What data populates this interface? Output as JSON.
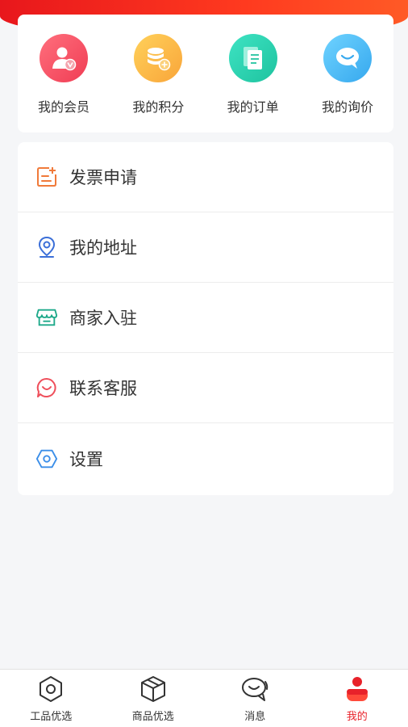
{
  "quick_actions": [
    {
      "label": "我的会员",
      "icon": "member-icon",
      "color": "#f03d54"
    },
    {
      "label": "我的积分",
      "icon": "coins-icon",
      "color": "#f9a53a"
    },
    {
      "label": "我的订单",
      "icon": "order-document-icon",
      "color": "#1ec39f"
    },
    {
      "label": "我的询价",
      "icon": "chat-bubble-icon",
      "color": "#36a8ee"
    }
  ],
  "menu": [
    {
      "label": "发票申请",
      "icon": "invoice-icon",
      "color": "#f07a3a"
    },
    {
      "label": "我的地址",
      "icon": "location-pin-icon",
      "color": "#3b6fd8"
    },
    {
      "label": "商家入驻",
      "icon": "storefront-icon",
      "color": "#1ea98a"
    },
    {
      "label": "联系客服",
      "icon": "customer-service-icon",
      "color": "#ef4f5b"
    },
    {
      "label": "设置",
      "icon": "settings-hexagon-icon",
      "color": "#3b8ee8"
    }
  ],
  "tabbar": [
    {
      "label": "工品优选",
      "icon": "hexagon-icon",
      "active": false
    },
    {
      "label": "商品优选",
      "icon": "box-icon",
      "active": false
    },
    {
      "label": "消息",
      "icon": "message-icon",
      "active": false
    },
    {
      "label": "我的",
      "icon": "profile-icon",
      "active": true
    }
  ],
  "colors": {
    "brand_red": "#e8222a",
    "background": "#f5f6f8"
  }
}
